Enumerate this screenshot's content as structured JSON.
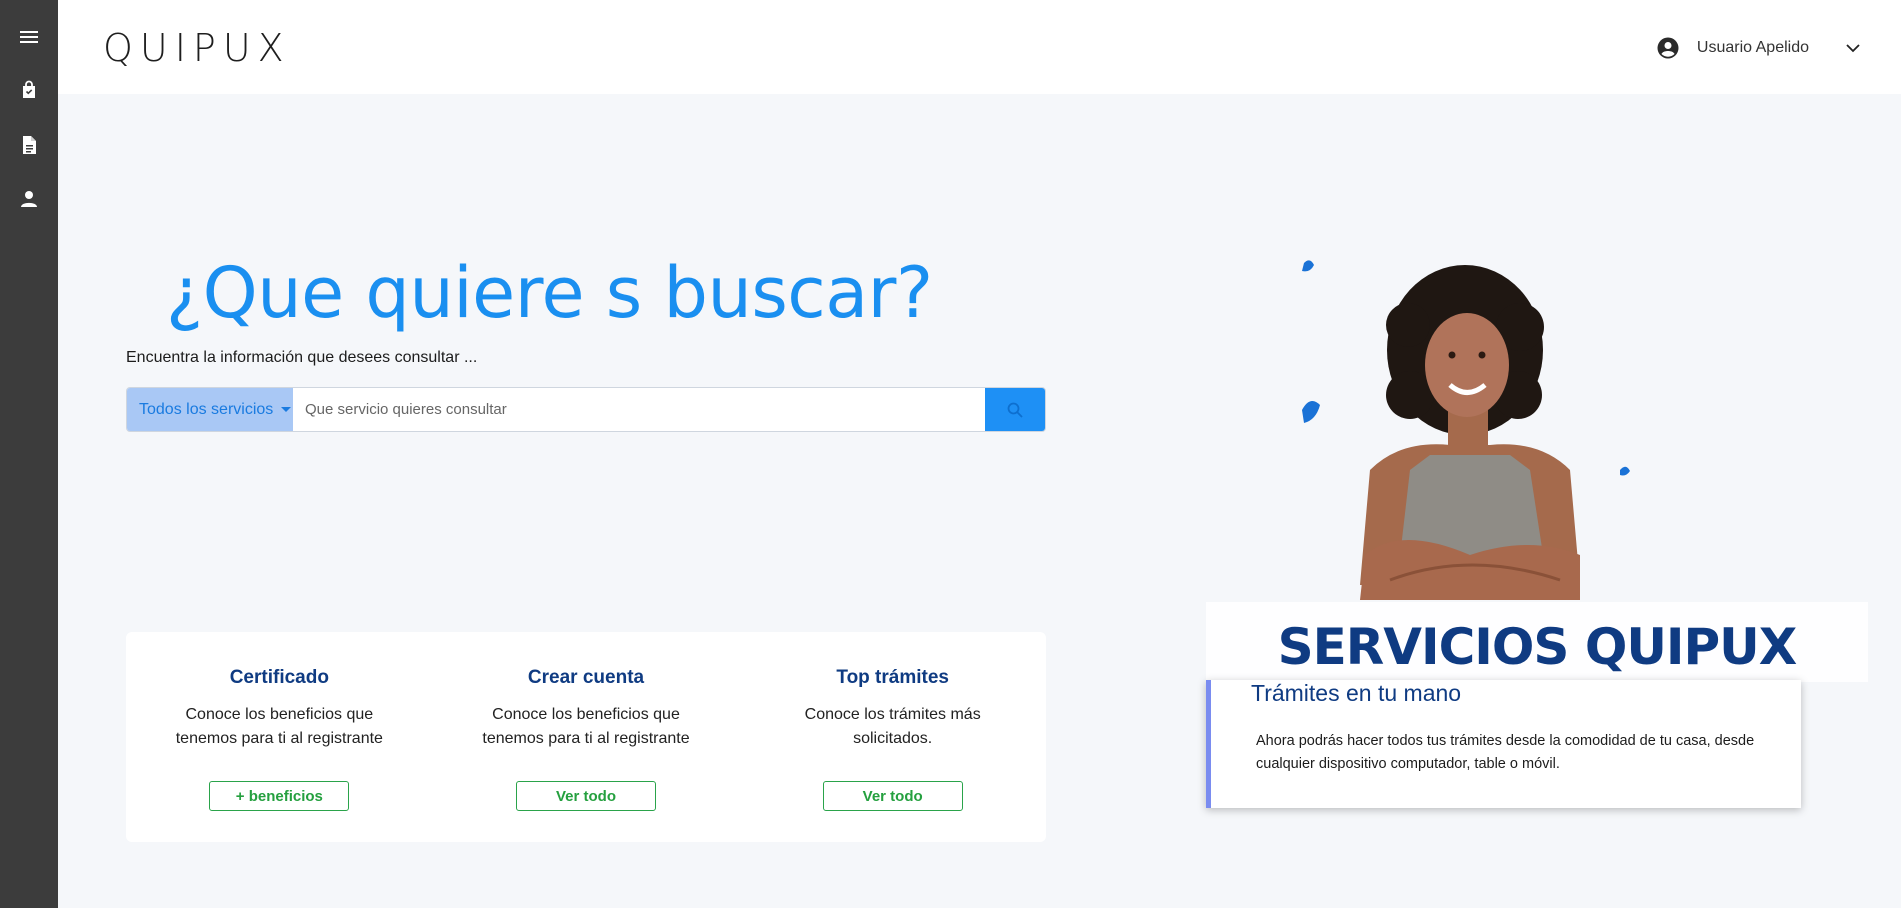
{
  "app": {
    "logo_text": "QUIPUX"
  },
  "sidebar": {
    "items": [
      {
        "icon": "menu-icon"
      },
      {
        "icon": "shopping-bag-icon"
      },
      {
        "icon": "document-icon"
      },
      {
        "icon": "user-icon"
      }
    ]
  },
  "header": {
    "user_name": "Usuario Apelido"
  },
  "hero": {
    "headline": "¿Que quiere s buscar?",
    "subline": "Encuentra la información que desees consultar ..."
  },
  "search": {
    "category_label": "Todos los servicios",
    "placeholder": "Que servicio quieres consultar"
  },
  "cards": [
    {
      "title": "Certificado",
      "text": "Conoce los beneficios que tenemos para ti al registrante",
      "button": "+ beneficios"
    },
    {
      "title": "Crear cuenta",
      "text": "Conoce los beneficios que tenemos para ti al registrante",
      "button": "Ver todo"
    },
    {
      "title": "Top trámites",
      "text": "Conoce los trámites más solicitados.",
      "button": "Ver todo"
    }
  ],
  "promo": {
    "title": "SERVICIOS QUIPUX",
    "subtitle": "Trámites en tu mano",
    "text": "Ahora podrás hacer todos tus trámites desde la comodidad de tu casa, desde cualquier dispositivo computador, table o móvil."
  },
  "colors": {
    "accent": "#1a8ff0",
    "navy": "#0f3b82",
    "green": "#25a03f",
    "sidebar": "#3c3c3c"
  }
}
